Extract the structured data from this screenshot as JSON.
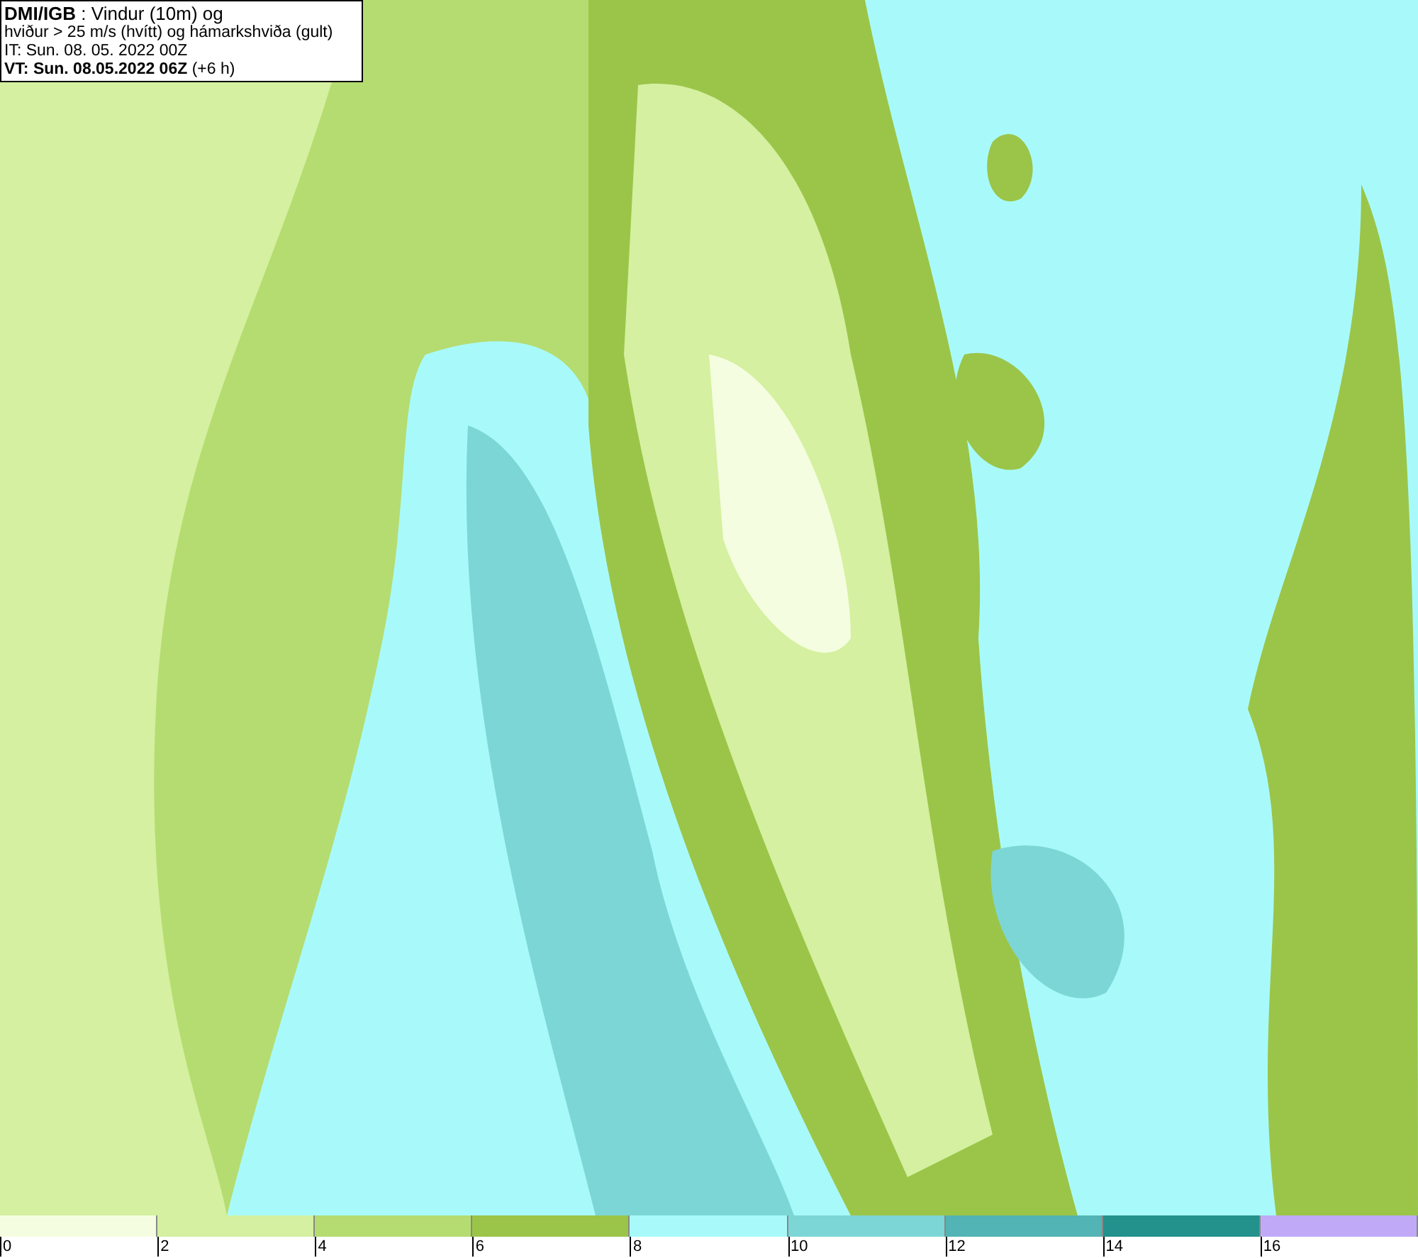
{
  "header": {
    "lines": [
      "**DMI/IGB** : Vindur (10m) og",
      "hviður > 25 m/s (hvítt) og hámarkshviða (gult)",
      "IT: Sun. 08. 05. 2022 00Z",
      "**VT: Sun. 08.05.2022 06Z** (+6 h)"
    ]
  },
  "legend": [
    {
      "label": "0",
      "color": "#f5fde0"
    },
    {
      "label": "2",
      "color": "#d4f0a0"
    },
    {
      "label": "4",
      "color": "#b5dc70"
    },
    {
      "label": "6",
      "color": "#9bc548"
    },
    {
      "label": "8",
      "color": "#a8fafa"
    },
    {
      "label": "10",
      "color": "#7dd6d6"
    },
    {
      "label": "12",
      "color": "#52b4b4"
    },
    {
      "label": "14",
      "color": "#23918c"
    },
    {
      "label": "16",
      "color": "#c0aaf8"
    }
  ]
}
